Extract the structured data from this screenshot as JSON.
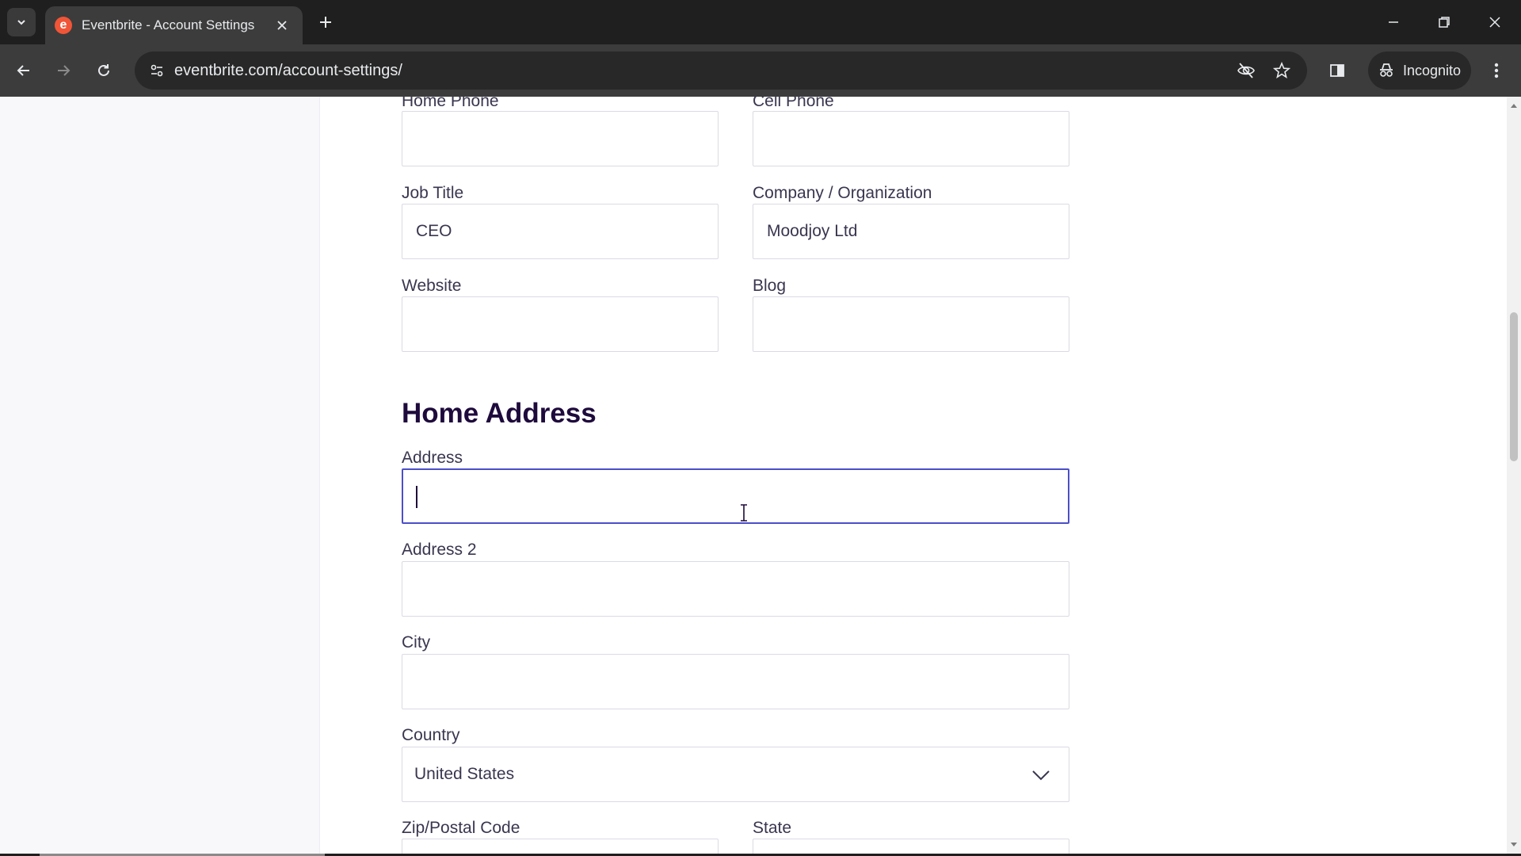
{
  "browser": {
    "tab_title": "Eventbrite - Account Settings",
    "favicon_letter": "e",
    "url": "eventbrite.com/account-settings/",
    "incognito_label": "Incognito",
    "brand_color": "#f05537"
  },
  "form": {
    "home_phone": {
      "label": "Home Phone",
      "value": ""
    },
    "cell_phone": {
      "label": "Cell Phone",
      "value": ""
    },
    "job_title": {
      "label": "Job Title",
      "value": "CEO"
    },
    "company": {
      "label": "Company / Organization",
      "value": "Moodjoy Ltd"
    },
    "website": {
      "label": "Website",
      "value": ""
    },
    "blog": {
      "label": "Blog",
      "value": ""
    }
  },
  "home_address": {
    "title": "Home Address",
    "address": {
      "label": "Address",
      "value": ""
    },
    "address2": {
      "label": "Address 2",
      "value": ""
    },
    "city": {
      "label": "City",
      "value": ""
    },
    "country": {
      "label": "Country",
      "value": "United States"
    },
    "zip": {
      "label": "Zip/Postal Code",
      "value": ""
    },
    "state": {
      "label": "State",
      "value": ""
    }
  }
}
